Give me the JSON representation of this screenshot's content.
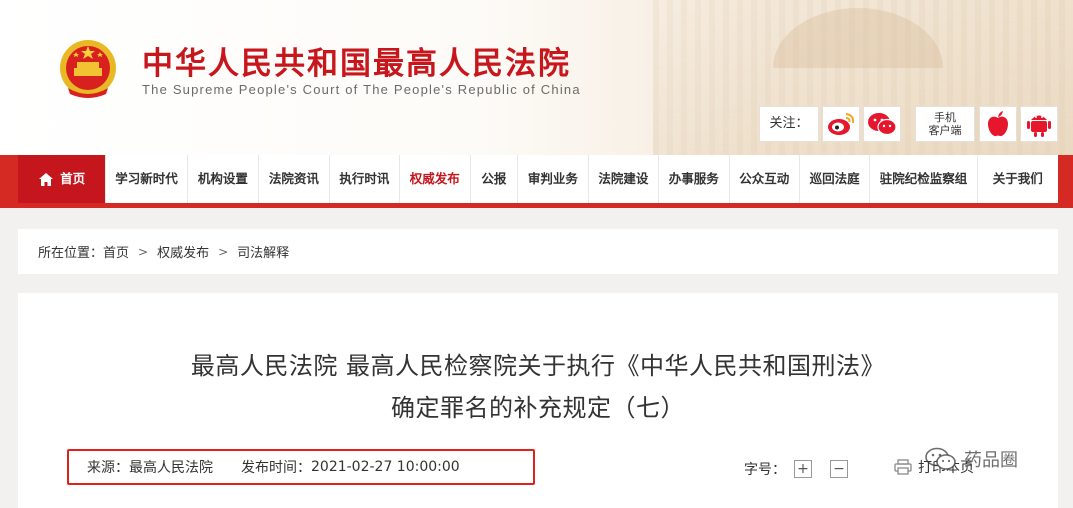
{
  "header": {
    "title": "中华人民共和国最高人民法院",
    "subtitle": "The Supreme People's Court of The People's Republic of China",
    "follow_label": "关注：",
    "mobile_label_line1": "手机",
    "mobile_label_line2": "客户端",
    "social_icons": [
      "weibo-icon",
      "wechat-icon",
      "apple-icon",
      "android-icon"
    ]
  },
  "nav": {
    "items": [
      {
        "label": "首页"
      },
      {
        "label": "学习新时代"
      },
      {
        "label": "机构设置"
      },
      {
        "label": "法院资讯"
      },
      {
        "label": "执行时讯"
      },
      {
        "label": "权威发布"
      },
      {
        "label": "公报"
      },
      {
        "label": "审判业务"
      },
      {
        "label": "法院建设"
      },
      {
        "label": "办事服务"
      },
      {
        "label": "公众互动"
      },
      {
        "label": "巡回法庭"
      },
      {
        "label": "驻院纪检监察组"
      },
      {
        "label": "关于我们"
      }
    ]
  },
  "breadcrumb": {
    "prefix": "所在位置：",
    "items": [
      "首页",
      "权威发布",
      "司法解释"
    ]
  },
  "article": {
    "title_line1": "最高人民法院 最高人民检察院关于执行《中华人民共和国刑法》",
    "title_line2": "确定罪名的补充规定（七）",
    "source_label": "来源：",
    "source_value": "最高人民法院",
    "time_label": "发布时间：",
    "time_value": "2021-02-27 10:00:00",
    "fontsize_label": "字号：",
    "fontsize_increase": "+",
    "fontsize_decrease": "−",
    "print_label": "打印本页"
  },
  "watermark": {
    "text": "药品圈"
  },
  "colors": {
    "brand_red": "#c4161c",
    "nav_bar": "#d52a24",
    "highlight_border": "#e1211b"
  }
}
